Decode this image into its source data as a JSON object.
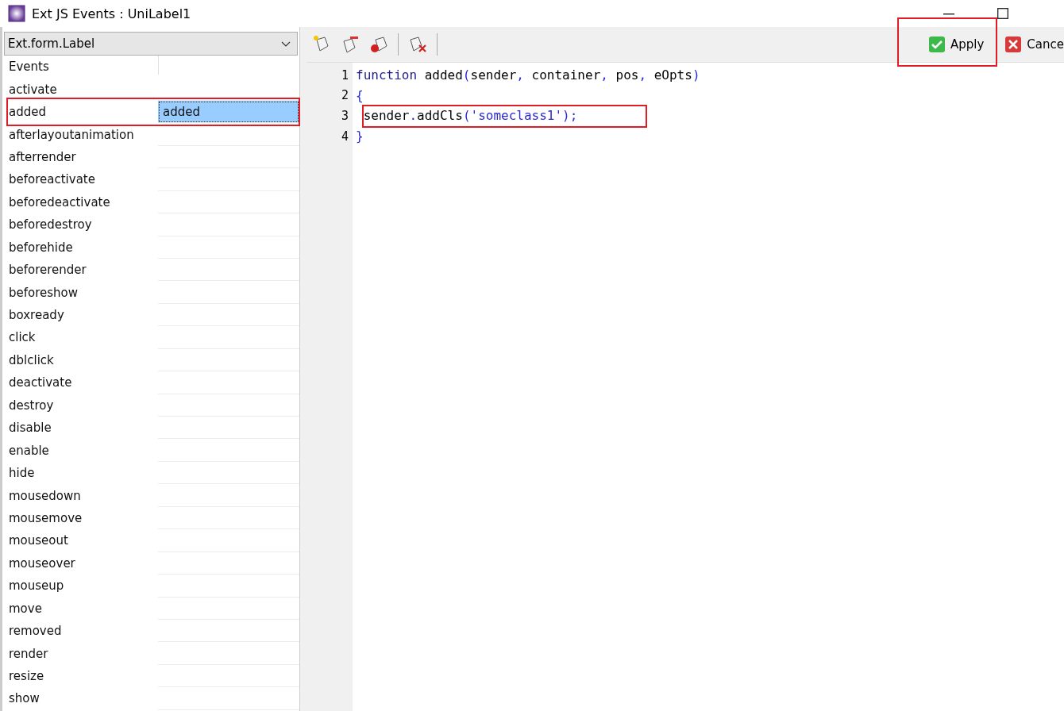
{
  "window": {
    "title": "Ext JS Events : UniLabel1"
  },
  "class_select": {
    "value": "Ext.form.Label"
  },
  "events_header": "Events",
  "events": [
    {
      "name": "activate",
      "selected": false
    },
    {
      "name": "added",
      "handler": "added",
      "selected": true,
      "highlighted": true
    },
    {
      "name": "afterlayoutanimation",
      "selected": false
    },
    {
      "name": "afterrender",
      "selected": false
    },
    {
      "name": "beforeactivate",
      "selected": false
    },
    {
      "name": "beforedeactivate",
      "selected": false
    },
    {
      "name": "beforedestroy",
      "selected": false
    },
    {
      "name": "beforehide",
      "selected": false
    },
    {
      "name": "beforerender",
      "selected": false
    },
    {
      "name": "beforeshow",
      "selected": false
    },
    {
      "name": "boxready",
      "selected": false
    },
    {
      "name": "click",
      "selected": false
    },
    {
      "name": "dblclick",
      "selected": false
    },
    {
      "name": "deactivate",
      "selected": false
    },
    {
      "name": "destroy",
      "selected": false
    },
    {
      "name": "disable",
      "selected": false
    },
    {
      "name": "enable",
      "selected": false
    },
    {
      "name": "hide",
      "selected": false
    },
    {
      "name": "mousedown",
      "selected": false
    },
    {
      "name": "mousemove",
      "selected": false
    },
    {
      "name": "mouseout",
      "selected": false
    },
    {
      "name": "mouseover",
      "selected": false
    },
    {
      "name": "mouseup",
      "selected": false
    },
    {
      "name": "move",
      "selected": false
    },
    {
      "name": "removed",
      "selected": false
    },
    {
      "name": "render",
      "selected": false
    },
    {
      "name": "resize",
      "selected": false
    },
    {
      "name": "show",
      "selected": false
    }
  ],
  "toolbar": {
    "actions": [
      {
        "label": "Apply",
        "kind": "apply",
        "highlighted": true
      },
      {
        "label": "Cance",
        "kind": "cancel"
      }
    ]
  },
  "code": [
    {
      "number": "1",
      "tokens": [
        {
          "kind": "keyword",
          "text": "function"
        },
        {
          "kind": "plain",
          "text": " added"
        },
        {
          "kind": "punct",
          "text": "("
        },
        {
          "kind": "plain",
          "text": "sender"
        },
        {
          "kind": "punct",
          "text": ","
        },
        {
          "kind": "plain",
          "text": " container"
        },
        {
          "kind": "punct",
          "text": ","
        },
        {
          "kind": "plain",
          "text": " pos"
        },
        {
          "kind": "punct",
          "text": ","
        },
        {
          "kind": "plain",
          "text": " eOpts"
        },
        {
          "kind": "punct",
          "text": ")"
        }
      ]
    },
    {
      "number": "2",
      "tokens": [
        {
          "kind": "punct",
          "text": "{"
        }
      ]
    },
    {
      "number": "3",
      "highlighted": true,
      "tokens": [
        {
          "kind": "plain",
          "text": " sender"
        },
        {
          "kind": "punct",
          "text": "."
        },
        {
          "kind": "plain",
          "text": "addCls"
        },
        {
          "kind": "punct",
          "text": "("
        },
        {
          "kind": "string",
          "text": "'someclass1'"
        },
        {
          "kind": "punct",
          "text": ");"
        }
      ]
    },
    {
      "number": "4",
      "tokens": [
        {
          "kind": "punct",
          "text": "}"
        }
      ]
    }
  ]
}
